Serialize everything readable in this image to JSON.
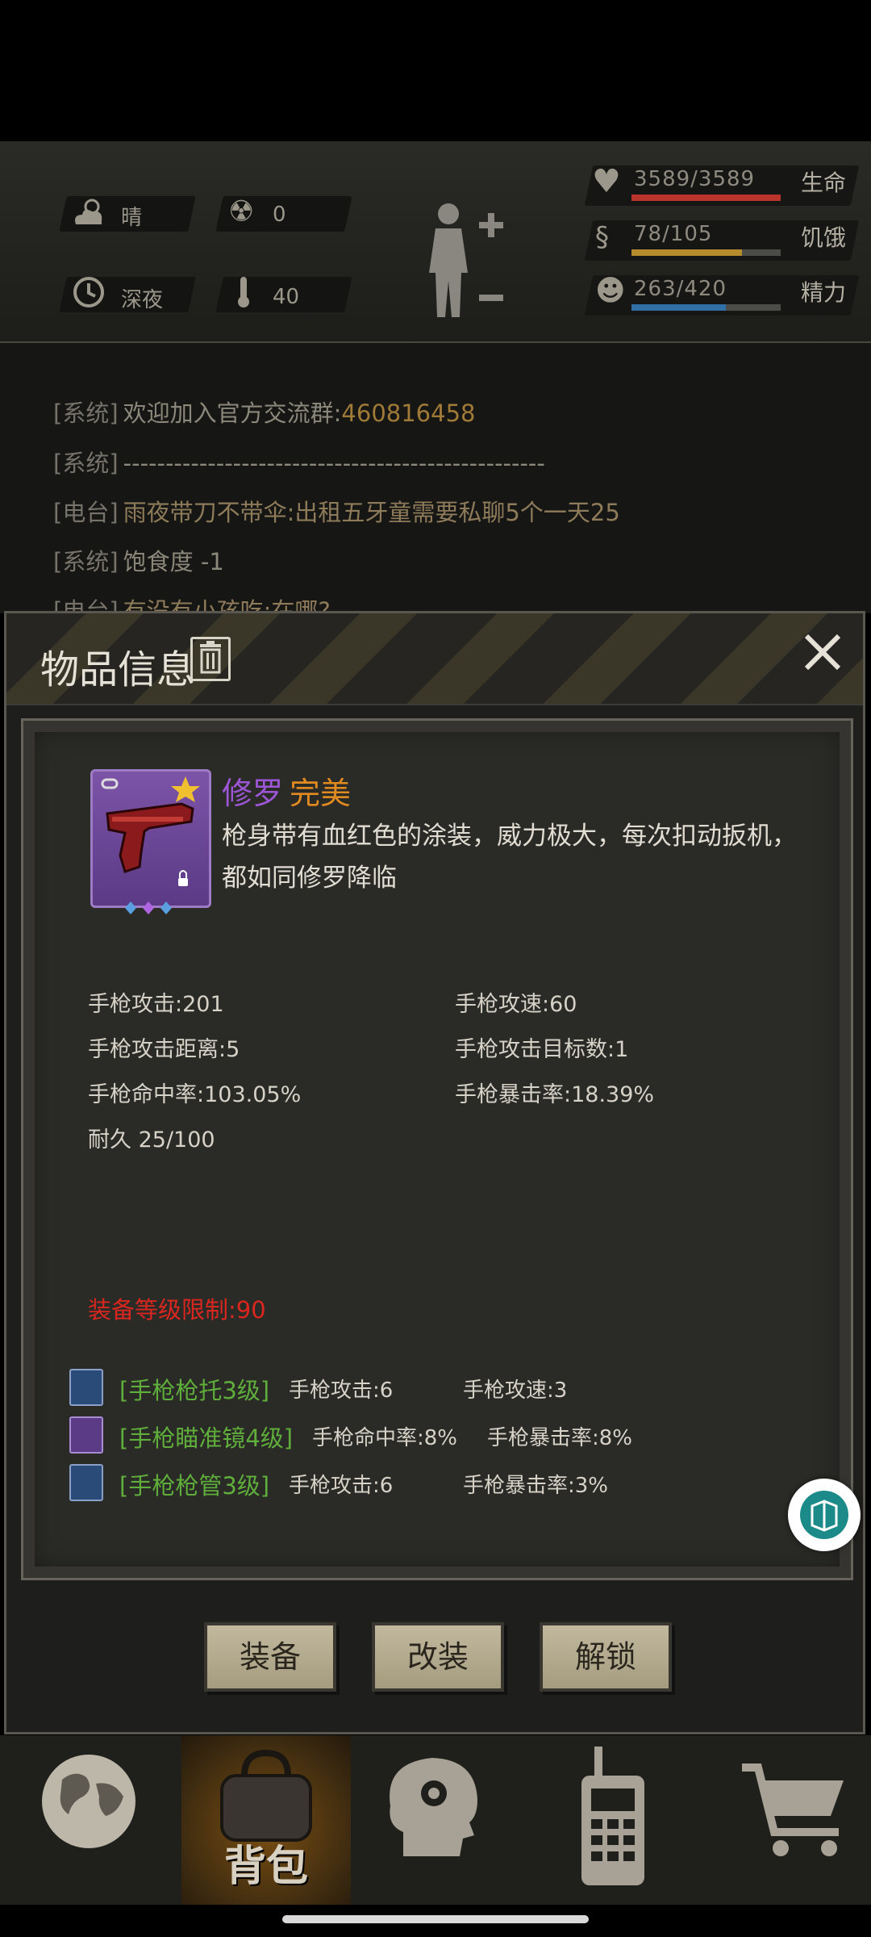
{
  "hud": {
    "weather": "晴",
    "radiation": "0",
    "time_of_day": "深夜",
    "temperature": "40",
    "stats": [
      {
        "value": "3589/3589",
        "name": "生命",
        "fraction": 1.0,
        "color": "#b8342c"
      },
      {
        "value": "78/105",
        "name": "饥饿",
        "fraction": 0.74,
        "color": "#b48c2e"
      },
      {
        "value": "263/420",
        "name": "精力",
        "fraction": 0.63,
        "color": "#2f6fa6"
      }
    ]
  },
  "log": {
    "lines": [
      {
        "tag": "[系统]",
        "who": "欢迎加入官方交流群:",
        "text": "460816458"
      },
      {
        "tag": "[系统]",
        "who": "",
        "text": "--------------------------------------------------"
      },
      {
        "tag": "[电台]",
        "who": "",
        "text": "雨夜带刀不带伞:出租五牙童需要私聊5个一天25"
      },
      {
        "tag": "[系统]",
        "who": "饱食度 -1",
        "text": ""
      },
      {
        "tag": "[电台]",
        "who": "",
        "text": "有没有小孩吃:在哪?"
      }
    ]
  },
  "dialog": {
    "title": "物品信息",
    "item": {
      "name": "修罗",
      "quality": "完美",
      "description": "枪身带有血红色的涂装，威力极大，每次扣动扳机，都如同修罗降临"
    },
    "attributes": [
      "手枪攻击:201",
      "手枪攻速:60",
      "手枪攻击距离:5",
      "手枪攻击目标数:1",
      "手枪命中率:103.05%",
      "手枪暴击率:18.39%",
      "耐久 25/100"
    ],
    "level_limit": "装备等级限制:90",
    "mods": [
      {
        "name": "[手枪枪托3级]",
        "v1": "手枪攻击:6",
        "v2": "手枪攻速:3"
      },
      {
        "name": "[手枪瞄准镜4级]",
        "v1": "手枪命中率:8%",
        "v2": "手枪暴击率:8%"
      },
      {
        "name": "[手枪枪管3级]",
        "v1": "手枪攻击:6",
        "v2": "手枪暴击率:3%"
      }
    ],
    "buttons": {
      "equip": "装备",
      "modify": "改装",
      "unlock": "解锁"
    }
  },
  "nav": {
    "backpack_label": "背包"
  }
}
